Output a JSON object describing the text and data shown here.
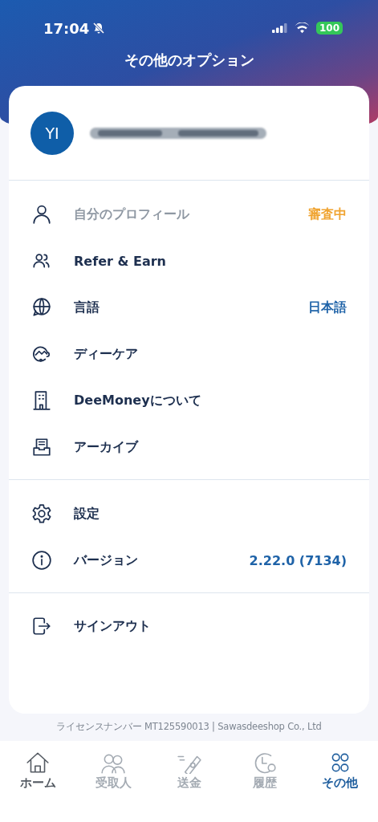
{
  "status_bar": {
    "time": "17:04",
    "battery": "100"
  },
  "title": "その他のオプション",
  "profile": {
    "initials": "YI"
  },
  "menu_groups": [
    {
      "items": [
        {
          "kind": "person",
          "label": "自分のプロフィール",
          "disabled": true,
          "value": {
            "text": "審査中",
            "color": "#f0a431"
          }
        },
        {
          "kind": "people",
          "label": "Refer & Earn",
          "disabled": false
        },
        {
          "kind": "globe",
          "label": "言語",
          "disabled": false,
          "value": {
            "text": "日本語",
            "color": "#1f63a8"
          }
        },
        {
          "kind": "care",
          "label": "ディーケア",
          "disabled": false
        },
        {
          "kind": "building",
          "label": "DeeMoneyについて",
          "disabled": false
        },
        {
          "kind": "archive",
          "label": "アーカイブ",
          "disabled": false
        }
      ]
    },
    {
      "items": [
        {
          "kind": "gear",
          "label": "設定",
          "disabled": false
        },
        {
          "kind": "info",
          "label": "バージョン",
          "disabled": false,
          "value": {
            "text": "2.22.0 (7134)",
            "color": "#1f63a8"
          }
        }
      ]
    },
    {
      "items": [
        {
          "kind": "signout",
          "label": "サインアウト",
          "disabled": false
        }
      ]
    }
  ],
  "footer": "ライセンスナンバー MT125590013 | Sawasdeeshop Co., Ltd",
  "nav": [
    {
      "kind": "home",
      "label": "ホーム",
      "selected": false,
      "disabled": false
    },
    {
      "kind": "recipients",
      "label": "受取人",
      "selected": false,
      "disabled": true
    },
    {
      "kind": "send",
      "label": "送金",
      "selected": false,
      "disabled": true
    },
    {
      "kind": "history",
      "label": "履歴",
      "selected": false,
      "disabled": true
    },
    {
      "kind": "more",
      "label": "その他",
      "selected": true,
      "disabled": false
    }
  ]
}
